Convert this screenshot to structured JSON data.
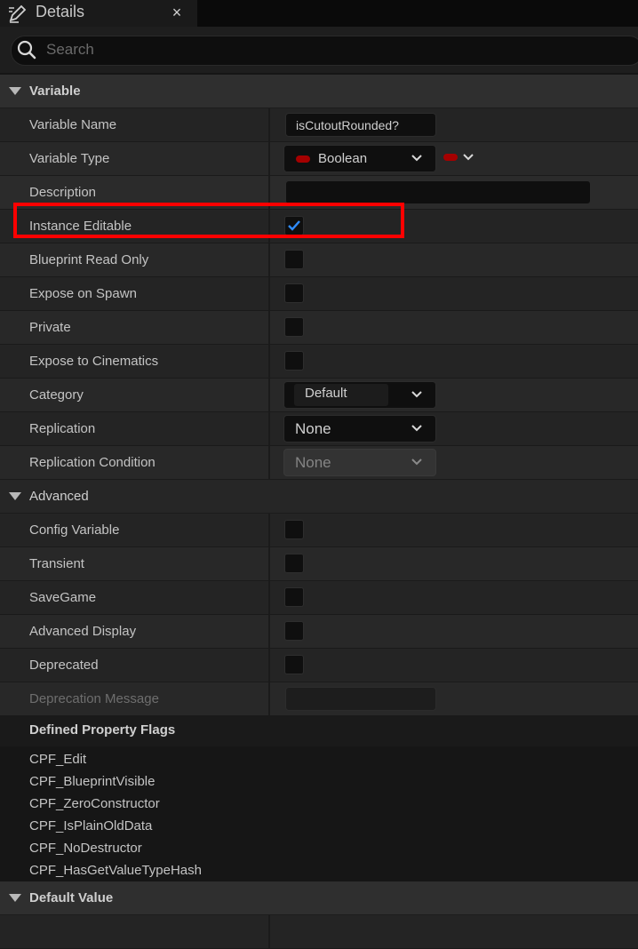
{
  "tab": {
    "title": "Details",
    "close": "×"
  },
  "search": {
    "placeholder": "Search",
    "value": ""
  },
  "sections": {
    "variable": "Variable",
    "advanced": "Advanced",
    "default_value": "Default Value"
  },
  "fields": {
    "variable_name": {
      "label": "Variable Name",
      "value": "isCutoutRounded?"
    },
    "variable_type": {
      "label": "Variable Type",
      "value": "Boolean",
      "pin_color": "#a50000"
    },
    "description": {
      "label": "Description",
      "value": ""
    },
    "instance_editable": {
      "label": "Instance Editable",
      "checked": true
    },
    "blueprint_read_only": {
      "label": "Blueprint Read Only",
      "checked": false
    },
    "expose_on_spawn": {
      "label": "Expose on Spawn",
      "checked": false
    },
    "private": {
      "label": "Private",
      "checked": false
    },
    "expose_to_cinematics": {
      "label": "Expose to Cinematics",
      "checked": false
    },
    "category": {
      "label": "Category",
      "value": "Default"
    },
    "replication": {
      "label": "Replication",
      "value": "None"
    },
    "replication_condition": {
      "label": "Replication Condition",
      "value": "None"
    },
    "config_variable": {
      "label": "Config Variable",
      "checked": false
    },
    "transient": {
      "label": "Transient",
      "checked": false
    },
    "savegame": {
      "label": "SaveGame",
      "checked": false
    },
    "advanced_display": {
      "label": "Advanced Display",
      "checked": false
    },
    "deprecated": {
      "label": "Deprecated",
      "checked": false
    },
    "deprecation_message": {
      "label": "Deprecation Message",
      "value": ""
    }
  },
  "property_flags": {
    "title": "Defined Property Flags",
    "items": [
      "CPF_Edit",
      "CPF_BlueprintVisible",
      "CPF_ZeroConstructor",
      "CPF_IsPlainOldData",
      "CPF_NoDestructor",
      "CPF_HasGetValueTypeHash"
    ]
  },
  "colors": {
    "checkmark": "#2f8cff",
    "highlight": "#ff0000",
    "boolean_pin": "#a50000"
  },
  "icons": [
    "edit-pencil-icon",
    "close-icon",
    "search-icon",
    "collapse-caret-icon",
    "chevron-down-icon",
    "checkmark-icon"
  ]
}
